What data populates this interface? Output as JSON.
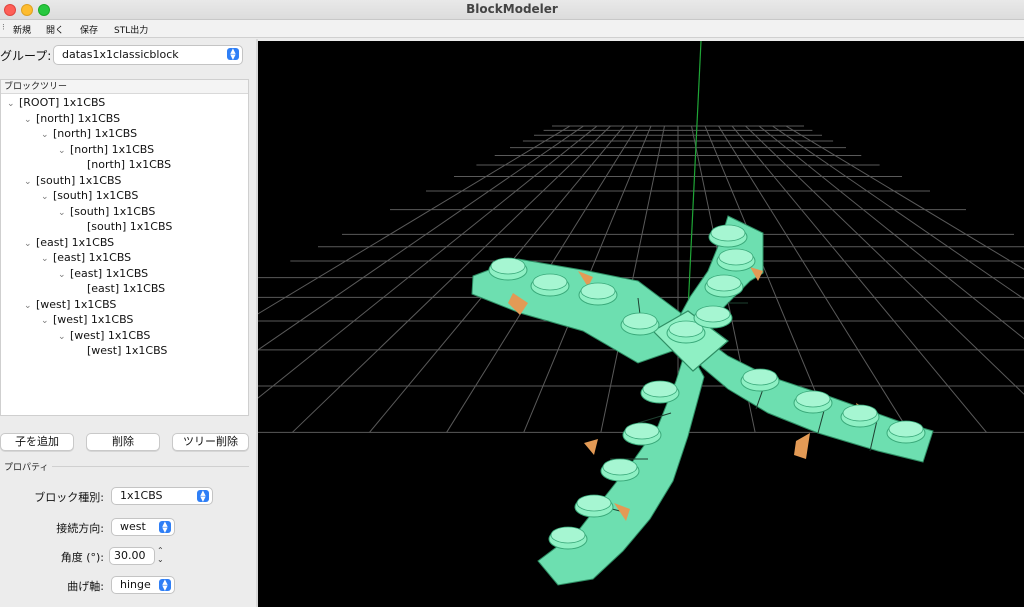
{
  "window": {
    "title": "BlockModeler"
  },
  "menu": {
    "items": [
      "新規",
      "開く",
      "保存",
      "STL出力"
    ]
  },
  "group": {
    "label": "グループ:",
    "selected": "datas1x1classicblock"
  },
  "tree": {
    "header": "ブロックツリー",
    "nodes": [
      "[ROOT] 1x1CBS",
      "[north] 1x1CBS",
      "[north] 1x1CBS",
      "[north] 1x1CBS",
      "[north] 1x1CBS",
      "[south] 1x1CBS",
      "[south] 1x1CBS",
      "[south] 1x1CBS",
      "[south] 1x1CBS",
      "[east] 1x1CBS",
      "[east] 1x1CBS",
      "[east] 1x1CBS",
      "[east] 1x1CBS",
      "[west] 1x1CBS",
      "[west] 1x1CBS",
      "[west] 1x1CBS",
      "[west] 1x1CBS"
    ]
  },
  "actions": {
    "add_child": "子を追加",
    "delete": "削除",
    "delete_tree": "ツリー削除"
  },
  "properties": {
    "header": "プロパティ",
    "block_type_label": "ブロック種別:",
    "block_type_value": "1x1CBS",
    "direction_label": "接続方向:",
    "direction_value": "west",
    "angle_label": "角度 (°):",
    "angle_value": "30.00",
    "bend_axis_label": "曲げ軸:",
    "bend_axis_value": "hinge"
  },
  "colors": {
    "block_top": "#8ff0c4",
    "block_side": "#6ddfb0",
    "block_dark": "#4cc793",
    "joint": "#e39a55",
    "grid": "#5a5a5a",
    "axis_green": "#1fa637",
    "viewport_bg": "#000000"
  }
}
